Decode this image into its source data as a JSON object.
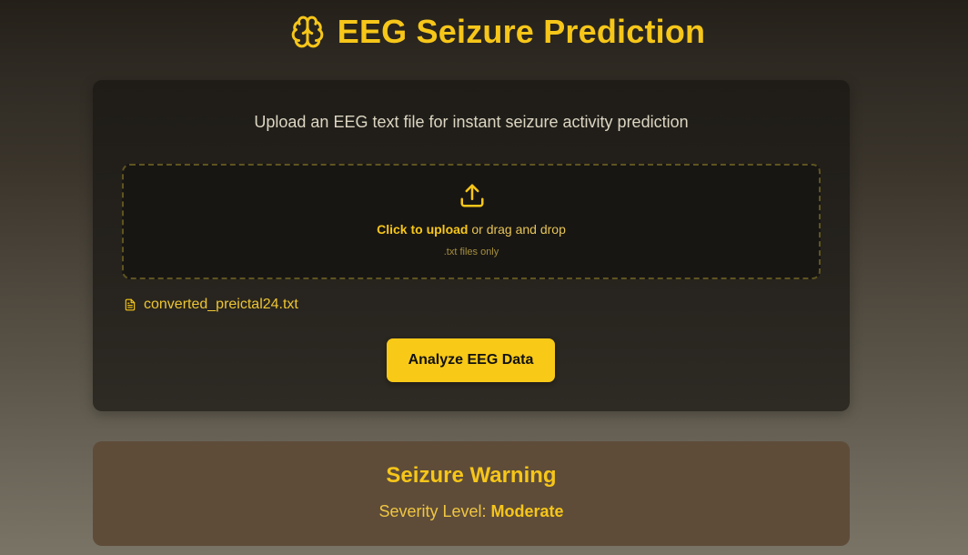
{
  "header": {
    "icon": "brain-icon",
    "title": "EEG Seizure Prediction"
  },
  "upload_card": {
    "subtitle": "Upload an EEG text file for instant seizure activity prediction",
    "dropzone": {
      "icon": "upload-icon",
      "click_label": "Click to upload",
      "drag_label": " or drag and drop",
      "hint": ".txt files only"
    },
    "selected_file": {
      "icon": "file-icon",
      "name": "converted_preictal24.txt"
    },
    "analyze_button": "Analyze EEG Data"
  },
  "result": {
    "title": "Seizure Warning",
    "severity_label": "Severity Level: ",
    "severity_value": "Moderate"
  },
  "colors": {
    "accent": "#f6c619",
    "card_bg": "#1f1c18",
    "warning_bg": "#5e4c39"
  }
}
